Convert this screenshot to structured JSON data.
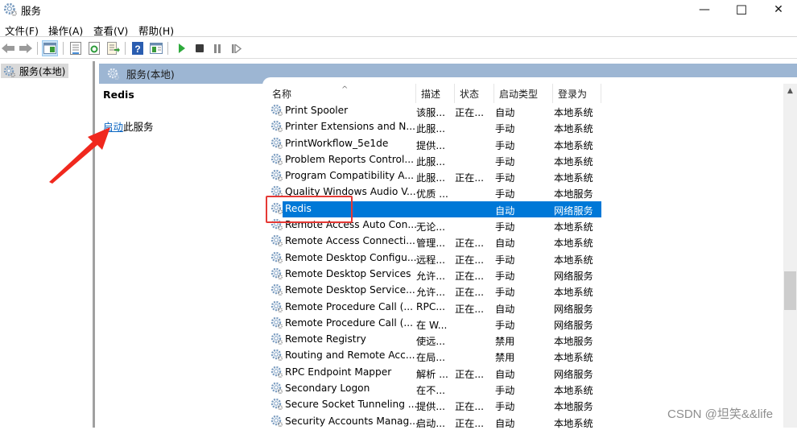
{
  "window": {
    "title": "服务",
    "controls": {
      "minimize": "—",
      "maximize": "☐",
      "close": "✕"
    }
  },
  "menubar": {
    "items": [
      "文件(F)",
      "操作(A)",
      "查看(V)",
      "帮助(H)"
    ]
  },
  "toolbar": {
    "buttons": [
      "back-icon",
      "forward-icon",
      "show-hide-console-tree-icon",
      "properties-icon",
      "refresh-icon",
      "export-list-icon",
      "help-icon",
      "show-action-pane-icon",
      "start-service-icon",
      "stop-service-icon",
      "pause-service-icon",
      "resume-service-icon"
    ]
  },
  "tree": {
    "root_label": "服务(本地)"
  },
  "pane": {
    "header": "服务(本地)",
    "selected_service": "Redis",
    "action_link": "启动",
    "action_suffix": "此服务"
  },
  "table": {
    "columns": [
      "名称",
      "描述",
      "状态",
      "启动类型",
      "登录为"
    ],
    "sorted_by": "名称",
    "rows": [
      {
        "name": "Print Spooler",
        "desc": "该服...",
        "status": "正在...",
        "startup": "自动",
        "logon": "本地系统"
      },
      {
        "name": "Printer Extensions and N...",
        "desc": "此服...",
        "status": "",
        "startup": "手动",
        "logon": "本地系统"
      },
      {
        "name": "PrintWorkflow_5e1de",
        "desc": "提供...",
        "status": "",
        "startup": "手动",
        "logon": "本地系统"
      },
      {
        "name": "Problem Reports Control...",
        "desc": "此服...",
        "status": "",
        "startup": "手动",
        "logon": "本地系统"
      },
      {
        "name": "Program Compatibility A...",
        "desc": "此服...",
        "status": "正在...",
        "startup": "手动",
        "logon": "本地系统"
      },
      {
        "name": "Quality Windows Audio V...",
        "desc": "优质 ...",
        "status": "",
        "startup": "手动",
        "logon": "本地服务"
      },
      {
        "name": "Redis",
        "desc": "",
        "status": "",
        "startup": "自动",
        "logon": "网络服务",
        "selected": true
      },
      {
        "name": "Remote Access Auto Con...",
        "desc": "无论...",
        "status": "",
        "startup": "手动",
        "logon": "本地系统"
      },
      {
        "name": "Remote Access Connecti...",
        "desc": "管理...",
        "status": "正在...",
        "startup": "自动",
        "logon": "本地系统"
      },
      {
        "name": "Remote Desktop Configu...",
        "desc": "远程...",
        "status": "正在...",
        "startup": "手动",
        "logon": "本地系统"
      },
      {
        "name": "Remote Desktop Services",
        "desc": "允许...",
        "status": "正在...",
        "startup": "手动",
        "logon": "网络服务"
      },
      {
        "name": "Remote Desktop Service...",
        "desc": "允许...",
        "status": "正在...",
        "startup": "手动",
        "logon": "本地系统"
      },
      {
        "name": "Remote Procedure Call (...",
        "desc": "RPC...",
        "status": "正在...",
        "startup": "自动",
        "logon": "网络服务"
      },
      {
        "name": "Remote Procedure Call (...",
        "desc": "在 W...",
        "status": "",
        "startup": "手动",
        "logon": "网络服务"
      },
      {
        "name": "Remote Registry",
        "desc": "使远...",
        "status": "",
        "startup": "禁用",
        "logon": "本地服务"
      },
      {
        "name": "Routing and Remote Acc...",
        "desc": "在局...",
        "status": "",
        "startup": "禁用",
        "logon": "本地系统"
      },
      {
        "name": "RPC Endpoint Mapper",
        "desc": "解析 ...",
        "status": "正在...",
        "startup": "自动",
        "logon": "网络服务"
      },
      {
        "name": "Secondary Logon",
        "desc": "在不...",
        "status": "",
        "startup": "手动",
        "logon": "本地系统"
      },
      {
        "name": "Secure Socket Tunneling ...",
        "desc": "提供...",
        "status": "正在...",
        "startup": "手动",
        "logon": "本地服务"
      },
      {
        "name": "Security Accounts Manag...",
        "desc": "启动...",
        "status": "正在...",
        "startup": "自动",
        "logon": "本地系统"
      }
    ]
  },
  "scrollbar": {
    "position_fraction": 0.55
  },
  "annotations": {
    "highlight_color": "#e53935",
    "arrow_color": "#f0281e"
  },
  "watermark": "CSDN @坦笑&&life",
  "colors": {
    "selection": "#0078d7",
    "pane_header": "#9db6d3",
    "link": "#0b66c2"
  }
}
